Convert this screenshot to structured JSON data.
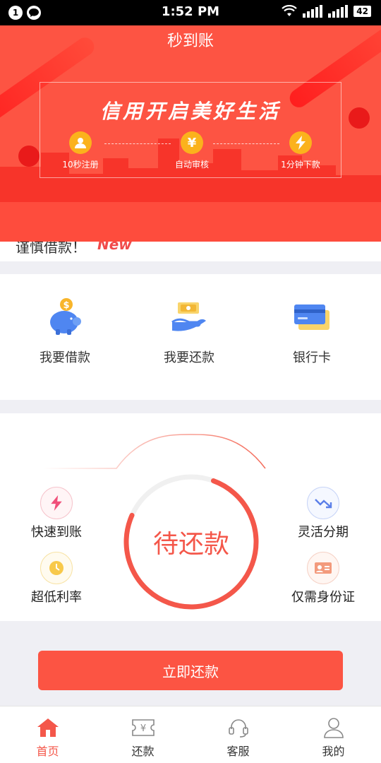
{
  "status_bar": {
    "notification_count": "1",
    "time": "1:52 PM",
    "battery": "42"
  },
  "banner": {
    "title": "秒到账",
    "slogan": "信用开启美好生活",
    "steps": [
      {
        "label": "10秒注册",
        "icon": "user-icon"
      },
      {
        "label": "自动审核",
        "icon": "yen-icon"
      },
      {
        "label": "1分钟下款",
        "icon": "lightning-icon"
      }
    ]
  },
  "notice": {
    "text": "谨慎借款！",
    "badge": "New"
  },
  "actions": [
    {
      "label": "我要借款",
      "icon": "piggy-bank-icon"
    },
    {
      "label": "我要还款",
      "icon": "hand-money-icon"
    },
    {
      "label": "银行卡",
      "icon": "bank-card-icon"
    }
  ],
  "repay_panel": {
    "center_label": "待还款",
    "features": [
      {
        "label": "快速到账",
        "icon": "lightning-icon"
      },
      {
        "label": "超低利率",
        "icon": "clock-icon"
      },
      {
        "label": "灵活分期",
        "icon": "trend-down-icon"
      },
      {
        "label": "仅需身份证",
        "icon": "id-card-icon"
      }
    ]
  },
  "repay_button": "立即还款",
  "bottom_nav": [
    {
      "label": "首页",
      "icon": "home-icon",
      "active": true
    },
    {
      "label": "还款",
      "icon": "ticket-icon",
      "active": false
    },
    {
      "label": "客服",
      "icon": "headset-icon",
      "active": false
    },
    {
      "label": "我的",
      "icon": "person-icon",
      "active": false
    }
  ],
  "colors": {
    "brand_red": "#fd5443",
    "accent_text": "#f4574a",
    "coin_yellow": "#fbb21c"
  }
}
